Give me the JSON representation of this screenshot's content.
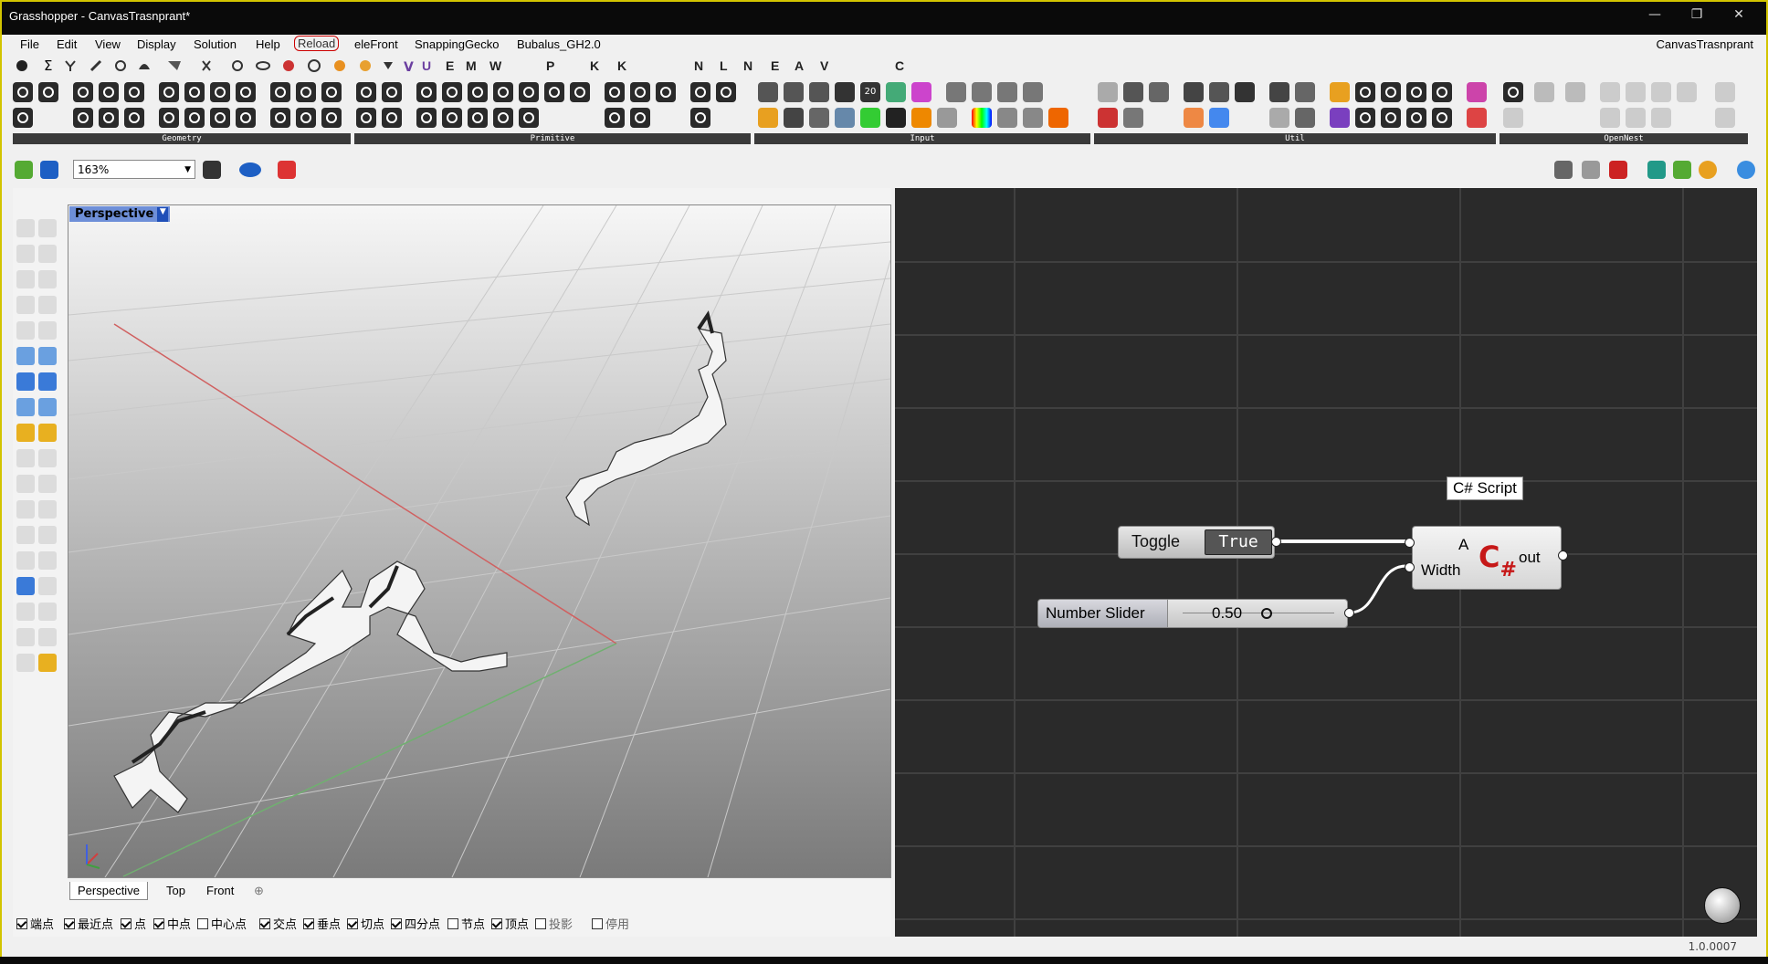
{
  "window": {
    "title": "Grasshopper - CanvasTrasnprant*",
    "controls": {
      "minimize": "—",
      "maximize": "❐",
      "close": "✕"
    }
  },
  "menu": {
    "items": [
      "File",
      "Edit",
      "View",
      "Display",
      "Solution",
      "Help",
      "Reload",
      "eleFront",
      "SnappingGecko",
      "Bubalus_GH2.0"
    ],
    "document": "CanvasTrasnprant"
  },
  "tabs": {
    "letters": [
      "E",
      "M",
      "W",
      "P",
      "K",
      "K",
      "N",
      "L",
      "N",
      "E",
      "A",
      "V",
      "C"
    ]
  },
  "ribbon": {
    "groups": [
      "Geometry",
      "Primitive",
      "Input",
      "Util",
      "OpenNest"
    ],
    "badge": "20"
  },
  "toolbar": {
    "zoom": "163%"
  },
  "viewport": {
    "label": "Perspective",
    "tabs": [
      "Perspective",
      "Top",
      "Front"
    ],
    "add_tab": "⊕"
  },
  "osnaps": [
    {
      "label": "端点",
      "on": true
    },
    {
      "label": "最近点",
      "on": true
    },
    {
      "label": "点",
      "on": true
    },
    {
      "label": "中点",
      "on": true
    },
    {
      "label": "中心点",
      "on": false
    },
    {
      "label": "交点",
      "on": true
    },
    {
      "label": "垂点",
      "on": true
    },
    {
      "label": "切点",
      "on": true
    },
    {
      "label": "四分点",
      "on": true
    },
    {
      "label": "节点",
      "on": false
    },
    {
      "label": "顶点",
      "on": true
    },
    {
      "label": "投影",
      "on": false
    },
    {
      "label": "停用",
      "on": false
    }
  ],
  "canvas": {
    "toggle": {
      "name": "Toggle",
      "value": "True"
    },
    "slider": {
      "name": "Number Slider",
      "value": "0.50"
    },
    "script": {
      "tooltip": "C# Script",
      "input_a": "A",
      "input_width": "Width",
      "output": "out",
      "logo": "C",
      "logo_sub": "#"
    }
  },
  "status": {
    "version": "1.0.0007"
  },
  "colors": {
    "canvas": "#2a2a2a",
    "title_bg": "#0a0a0a",
    "frame": "#d2c400",
    "viewport_label": "#6e8fd8",
    "csharp": "#c61818"
  }
}
